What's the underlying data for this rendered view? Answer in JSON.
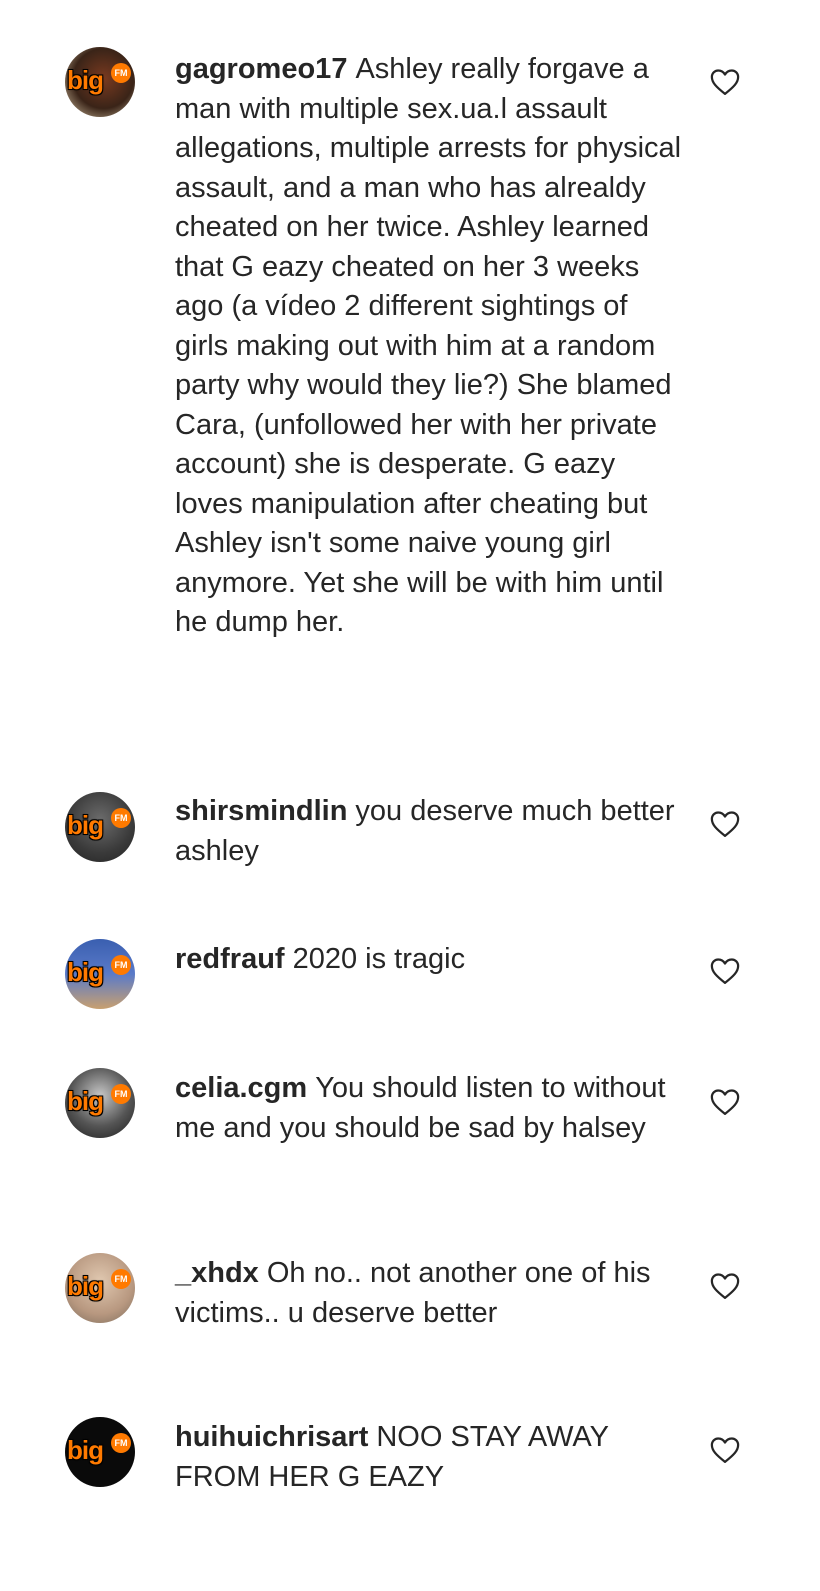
{
  "comments": [
    {
      "username": "gagromeo17",
      "text": "Ashley really forgave a man with multiple sex.ua.l assault allegations, multiple arrests for physical assault, and a man who has alrealdy cheated on her twice. Ashley learned that G eazy cheated on her 3 weeks ago (a vídeo 2 different sightings of girls making out with him at a random party why would they lie?) She blamed Cara, (unfollowed her with her private account) she is desperate. G eazy loves manipulation after cheating but Ashley isn't some naive young girl anymore. Yet she will be with him until he dump her.",
      "avatar_logo": "big",
      "avatar_badge": "FM"
    },
    {
      "username": "shirsmindlin",
      "text": "you deserve much better ashley",
      "avatar_logo": "big",
      "avatar_badge": "FM"
    },
    {
      "username": "redfrauf",
      "text": "2020 is tragic",
      "avatar_logo": "big",
      "avatar_badge": "FM"
    },
    {
      "username": "celia.cgm",
      "text": "You should listen to without me and you should be sad by halsey",
      "avatar_logo": "big",
      "avatar_badge": "FM"
    },
    {
      "username": "_xhdx",
      "text": "Oh no.. not another one of his victims.. u deserve better",
      "avatar_logo": "big",
      "avatar_badge": "FM"
    },
    {
      "username": "huihuichrisart",
      "text": "NOO STAY AWAY FROM HER G EAZY",
      "avatar_logo": "big",
      "avatar_badge": "FM"
    }
  ],
  "icons": {
    "like": "heart-outline-icon"
  },
  "colors": {
    "text": "#262626",
    "background": "#ffffff",
    "logo_orange": "#ff7a00"
  }
}
